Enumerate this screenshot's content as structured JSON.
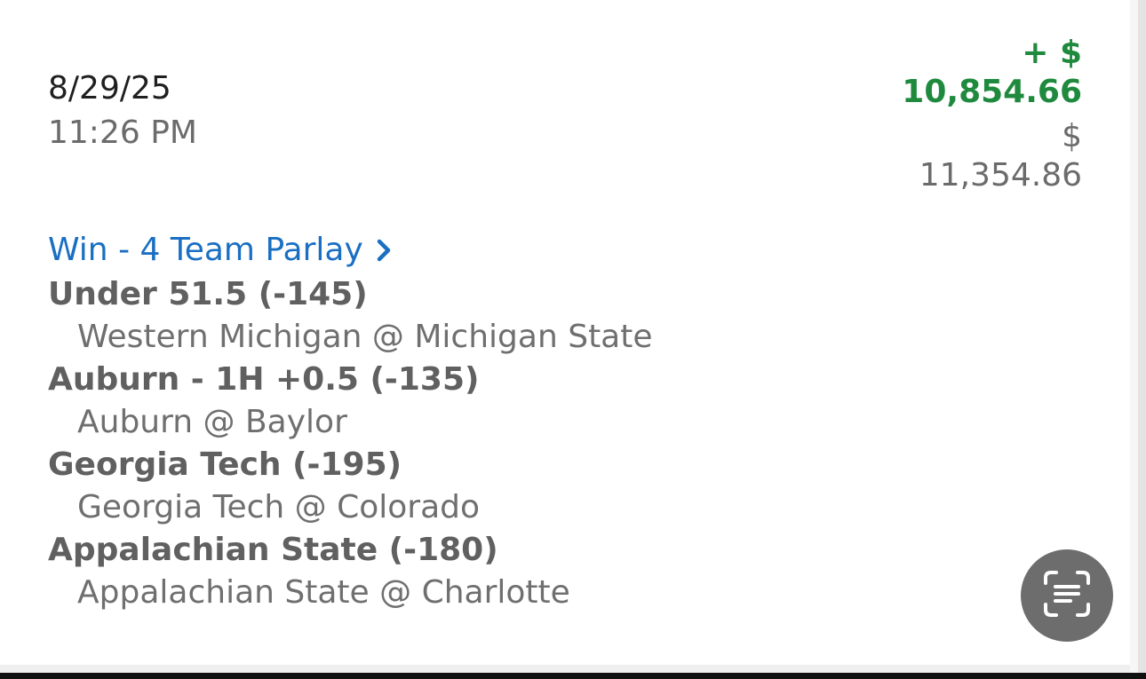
{
  "bet": {
    "date": "8/29/25",
    "time": "11:26 PM",
    "win_prefix": "+ $",
    "win_amount": "10,854.66",
    "total_prefix": "$",
    "total_amount": "11,354.86",
    "result_link": "Win - 4 Team Parlay",
    "link_icon": "chevron-right-icon",
    "legs": [
      {
        "pick": "Under 51.5 (-145)",
        "game": "Western Michigan @ Michigan State"
      },
      {
        "pick": "Auburn - 1H +0.5 (-135)",
        "game": "Auburn @ Baylor"
      },
      {
        "pick": "Georgia Tech (-195)",
        "game": "Georgia Tech @ Colorado"
      },
      {
        "pick": "Appalachian State (-180)",
        "game": "Appalachian State @ Charlotte"
      }
    ]
  },
  "fab": {
    "icon": "scan-text-icon"
  },
  "colors": {
    "win_green": "#1f8a3e",
    "link_blue": "#1a6fc2",
    "muted_gray": "#6b6b6b",
    "fab_gray": "#6d6d6d"
  }
}
